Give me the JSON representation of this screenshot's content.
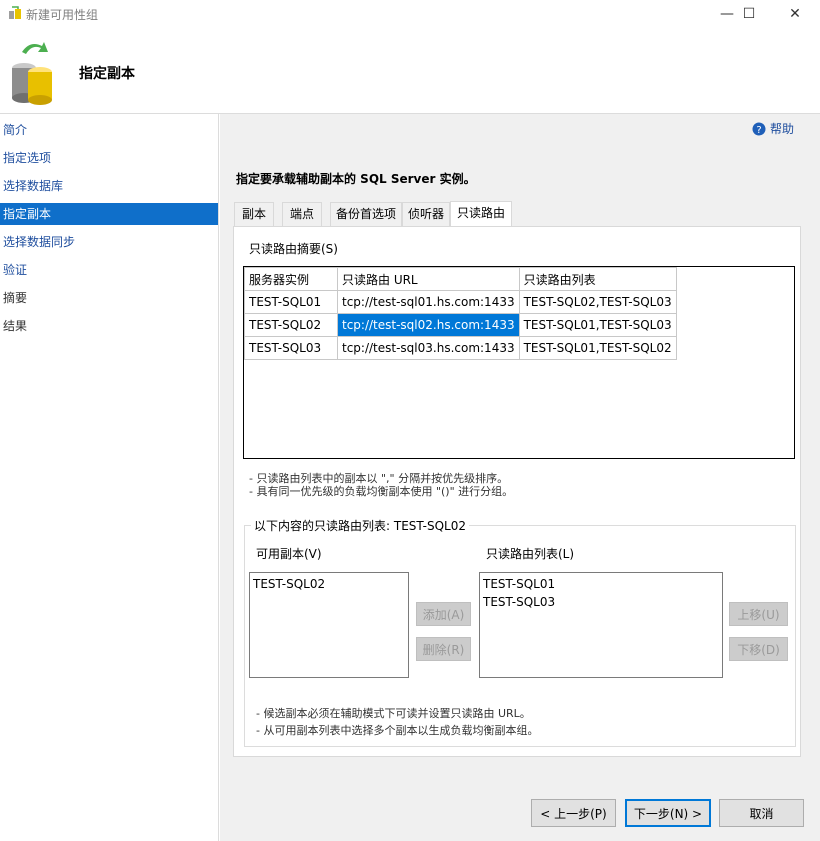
{
  "window": {
    "title": "新建可用性组"
  },
  "header": {
    "title": "指定副本"
  },
  "sidebar": {
    "items": [
      {
        "label": "简介"
      },
      {
        "label": "指定选项"
      },
      {
        "label": "选择数据库"
      },
      {
        "label": "指定副本"
      },
      {
        "label": "选择数据同步"
      },
      {
        "label": "验证"
      },
      {
        "label": "摘要"
      },
      {
        "label": "结果"
      }
    ]
  },
  "help": {
    "label": "帮助"
  },
  "instruction": "指定要承载辅助副本的 SQL Server 实例。",
  "tabs": [
    {
      "label": "副本"
    },
    {
      "label": "端点"
    },
    {
      "label": "备份首选项"
    },
    {
      "label": "侦听器"
    },
    {
      "label": "只读路由"
    }
  ],
  "summary": {
    "label": "只读路由摘要(S)",
    "columns": [
      "服务器实例",
      "只读路由 URL",
      "只读路由列表"
    ],
    "rows": [
      [
        "TEST-SQL01",
        "tcp://test-sql01.hs.com:1433",
        "TEST-SQL02,TEST-SQL03"
      ],
      [
        "TEST-SQL02",
        "tcp://test-sql02.hs.com:1433",
        "TEST-SQL01,TEST-SQL03"
      ],
      [
        "TEST-SQL03",
        "tcp://test-sql03.hs.com:1433",
        "TEST-SQL01,TEST-SQL02"
      ]
    ]
  },
  "notes1": [
    "- 只读路由列表中的副本以 \",\" 分隔并按优先级排序。",
    "- 具有同一优先级的负载均衡副本使用 \"()\" 进行分组。"
  ],
  "group": {
    "legend": "以下内容的只读路由列表: TEST-SQL02",
    "available_label": "可用副本(V)",
    "available": [
      "TEST-SQL02"
    ],
    "route_label": "只读路由列表(L)",
    "route": [
      "TEST-SQL01",
      "TEST-SQL03"
    ],
    "add": "添加(A)",
    "remove": "删除(R)",
    "up": "上移(U)",
    "down": "下移(D)"
  },
  "notes2": [
    "- 候选副本必须在辅助模式下可读并设置只读路由 URL。",
    "- 从可用副本列表中选择多个副本以生成负载均衡副本组。"
  ],
  "footer": {
    "prev": "< 上一步(P)",
    "next": "下一步(N) >",
    "cancel": "取消"
  }
}
